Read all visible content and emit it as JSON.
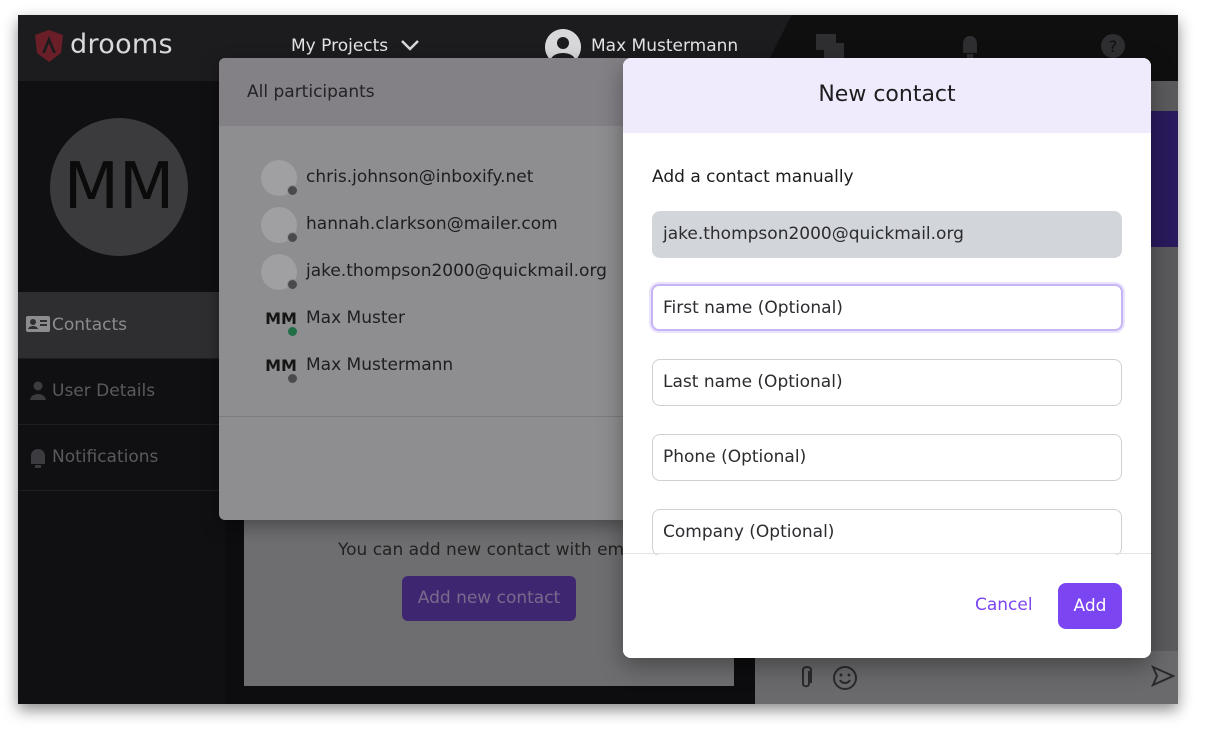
{
  "app": {
    "brand": "drooms"
  },
  "header": {
    "projects_label": "My Projects",
    "user_name": "Max Mustermann"
  },
  "profile": {
    "initials": "MM"
  },
  "sidebar": {
    "items": [
      {
        "label": "Contacts",
        "icon": "contact-card-icon",
        "active": true
      },
      {
        "label": "User Details",
        "icon": "person-icon",
        "active": false
      },
      {
        "label": "Notifications",
        "icon": "bell-icon",
        "active": false
      }
    ]
  },
  "main": {
    "empty_text": "You can add new contact with em",
    "add_button": "Add new contact"
  },
  "participants": {
    "title": "All participants",
    "list": [
      {
        "email": "chris.johnson@inboxify.net",
        "initials": "",
        "online": false
      },
      {
        "email": "hannah.clarkson@mailer.com",
        "initials": "",
        "online": false
      },
      {
        "email": "jake.thompson2000@quickmail.org",
        "initials": "",
        "online": false
      },
      {
        "email": "Max Muster",
        "initials": "MM",
        "online": true
      },
      {
        "email": "Max Mustermann",
        "initials": "MM",
        "online": false
      }
    ]
  },
  "modal": {
    "title": "New contact",
    "subtitle": "Add a contact manually",
    "email_value": "jake.thompson2000@quickmail.org",
    "first_name_placeholder": "First name (Optional)",
    "last_name_placeholder": "Last name (Optional)",
    "phone_placeholder": "Phone (Optional)",
    "company_placeholder": "Company (Optional)",
    "cancel_label": "Cancel",
    "add_label": "Add"
  },
  "colors": {
    "accent": "#7c45f2",
    "header_tint": "#efebfc",
    "online": "#1f6e45"
  }
}
